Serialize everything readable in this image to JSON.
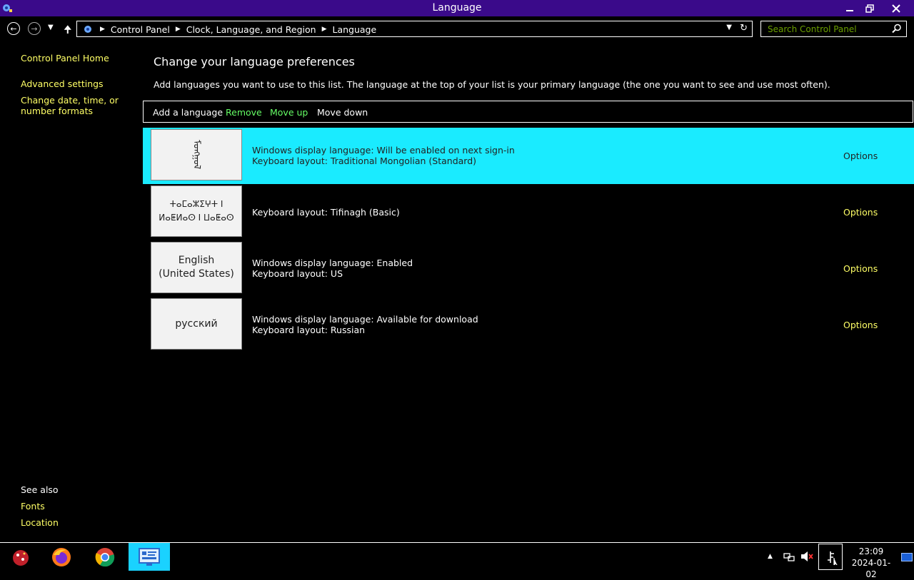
{
  "window": {
    "title": "Language",
    "minimize_icon": "minimize-icon",
    "restore_icon": "restore-icon",
    "close_icon": "close-icon",
    "accent": "#3a0a8a"
  },
  "address": {
    "crumbs": [
      "Control Panel",
      "Clock, Language, and Region",
      "Language"
    ],
    "search_placeholder": "Search Control Panel"
  },
  "sidebar": {
    "home": "Control Panel Home",
    "advanced": "Advanced settings",
    "date_formats": "Change date, time, or number formats",
    "see_also": "See also",
    "fonts": "Fonts",
    "location": "Location"
  },
  "main": {
    "heading": "Change your language preferences",
    "description": "Add languages you want to use to this list. The language at the top of your list is your primary language (the one you want to see and use most often).",
    "toolbar": {
      "add": "Add a language",
      "remove": "Remove",
      "move_up": "Move up",
      "move_down": "Move down"
    },
    "languages": [
      {
        "thumb": "ᠮᠣᠩᠭᠣᠯ",
        "line1": "Windows display language: Will be enabled on next sign-in",
        "line2": "Keyboard layout: Traditional Mongolian (Standard)",
        "options": "Options",
        "selected": true
      },
      {
        "thumb": "ⵜⴰⵎⴰⵣⵉⵖⵜ ⵏ ⵍⴰⵟⵍⴰⵙ ⵏ ⵡⴰⵟⴰⵙ",
        "line1": "Keyboard layout: Tifinagh (Basic)",
        "line2": "",
        "options": "Options",
        "selected": false
      },
      {
        "thumb": "English (United States)",
        "line1": "Windows display language: Enabled",
        "line2": "Keyboard layout: US",
        "options": "Options",
        "selected": false
      },
      {
        "thumb": "русский",
        "line1": "Windows display language: Available for download",
        "line2": "Keyboard layout: Russian",
        "options": "Options",
        "selected": false
      }
    ]
  },
  "taskbar": {
    "time": "23:09",
    "date": "2024-01-02",
    "apps": [
      "app-icon",
      "firefox-icon",
      "chrome-icon",
      "control-panel-icon"
    ]
  },
  "colors": {
    "link": "#ffff66",
    "enabled_action": "#66ff66",
    "selection": "#1aebff"
  }
}
